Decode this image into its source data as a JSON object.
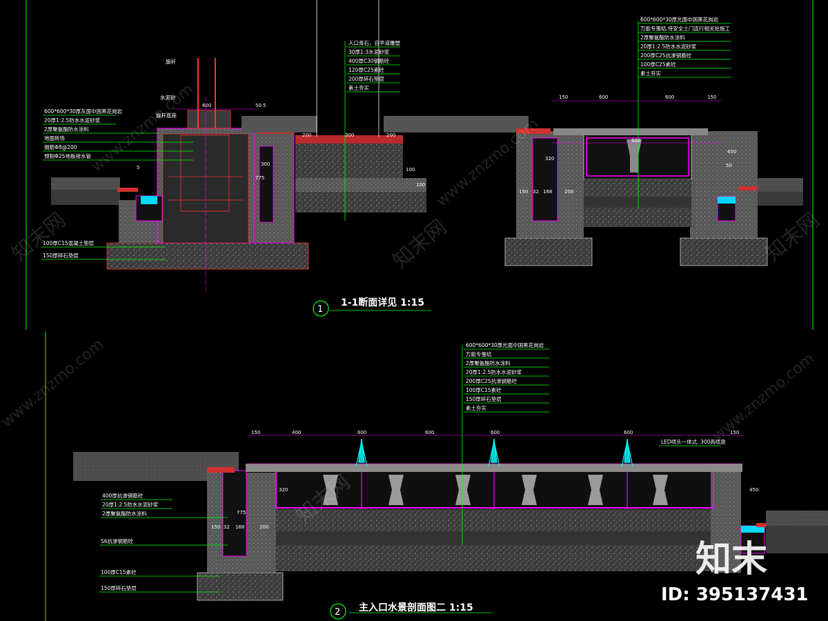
{
  "colors": {
    "background": "#000000",
    "ground": "#5a5a5a",
    "concrete": "#6e6e6e",
    "gravel": "#4a4a4a",
    "wall_outline": "#ff00ff",
    "leader": "#00ff00",
    "dimension": "#ffffff",
    "water": "#00ffff",
    "red_detail": "#ff3333"
  },
  "section1": {
    "number": "1",
    "title": "1-1断面详见 1:15",
    "notes_left": [
      "600*600*30厚灰面中国黑花岗岩",
      "20厚1:2.5防水水泥砂浆",
      "2厚聚氨酯防水涂料",
      "地面砖饰",
      "钢筋Φ8@200",
      "预制Φ25地板排水管"
    ],
    "notes_bottom_left": [
      "100厚C15混凝土垫层",
      "150厚碎石垫层"
    ],
    "notes_center": [
      "人口青石，自平道雕塑",
      "30厚1:3水泥砂浆",
      "400厚C30钢筋砼",
      "120厚C25素砼",
      "200厚碎石垫层",
      "素土夯实"
    ],
    "notes_right": [
      "600*600*30厚光面中国黑花岗岩",
      "万能专蛋结,侍安全土门连行相关处施工",
      "2厚聚氨酯防水涂料",
      "20厚1:2.5防水水泥砂浆",
      "200厚C25抗渗钢筋砼",
      "100厚C25素砼",
      "素土夯实"
    ],
    "labels_top": [
      "旗杆",
      "水泥砂",
      "旗杆底座"
    ],
    "dims": [
      "600",
      "50.5",
      "150",
      "600",
      "600",
      "150",
      "200",
      "300",
      "200",
      "100",
      "100",
      "775",
      "300",
      "50",
      "900",
      "450",
      "320",
      "150",
      "32",
      "168",
      "200",
      "5"
    ]
  },
  "section2": {
    "number": "2",
    "title": "主入口水景剖面图二 1:15",
    "notes_top": [
      "600*600*30厚光面中国黑花岗岩",
      "万能专蛋结",
      "2厚聚氨酯防水涂料",
      "20厚1:2.5防水水泥砂浆",
      "200厚C25抗渗钢筋砼",
      "100厚C15素砼",
      "150厚碎石垫层",
      "素土夯实"
    ],
    "notes_left": [
      "400厚抗渗钢筋砼",
      "20厚1:2.5防水水泥砂浆",
      "2厚聚氨酯防水涂料"
    ],
    "notes_left_lower": [
      "S6抗渗钢筋砼",
      "100厚C15素砼",
      "150厚碎石垫层"
    ],
    "fountain_note": "LED喷头一体式, 300高喷泉",
    "dims_top": [
      "150",
      "400",
      "600",
      "600",
      "600",
      "600",
      "150"
    ],
    "dims_side": [
      "320",
      "775",
      "150",
      "32",
      "168",
      "200",
      "450"
    ]
  },
  "watermark": {
    "site": "www.znzmo.com",
    "brand_cn": "知末网",
    "logo": "知末",
    "id_label": "ID: 395137431"
  }
}
